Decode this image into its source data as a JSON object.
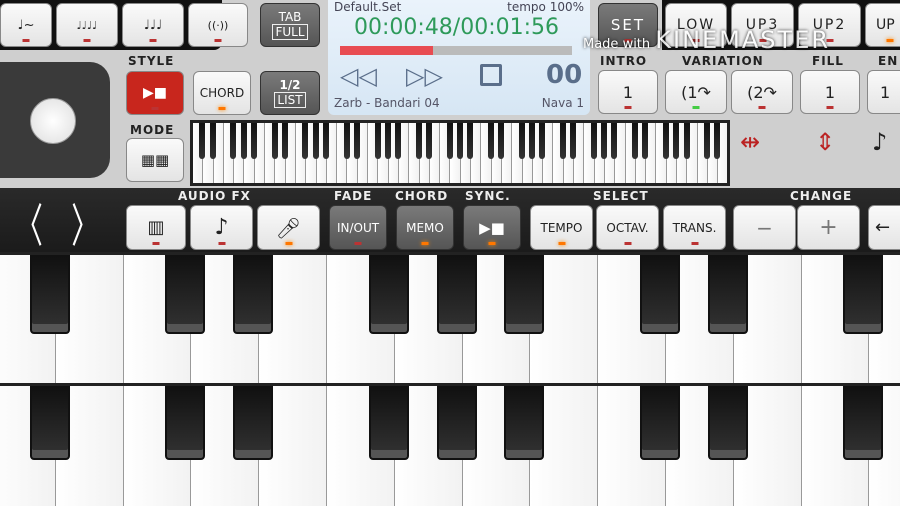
{
  "top_buttons": [
    {
      "icon": "note-tie-icon"
    },
    {
      "icon": "notes-decay-icon"
    },
    {
      "icon": "notes-staccato-icon"
    },
    {
      "icon": "vibrato-icon"
    }
  ],
  "tab_full": {
    "line1": "TAB",
    "line2": "FULL"
  },
  "style_label": "STYLE",
  "mode_label": "MODE",
  "chord_button": "CHORD",
  "list_button": {
    "line1": "1/2",
    "line2": "LIST"
  },
  "player": {
    "set_name": "Default.Set",
    "tempo": "tempo 100%",
    "time": "00:00:48/00:01:56",
    "progress": 0.4,
    "style_name": "Zarb - Bandari 04",
    "voice": "Nava 1",
    "accent": "#2e9a5a",
    "progress_color": "#e84c52"
  },
  "set_button": "SET",
  "parts": [
    "LOW",
    "UP3",
    "UP2",
    "UP"
  ],
  "watermark": {
    "made_with": "Made with",
    "brand": "KINEMASTER"
  },
  "sections": {
    "intro": "INTRO",
    "variation": "VARIATION",
    "fill": "FILL",
    "ending": "EN"
  },
  "section_buttons": [
    "1",
    "1",
    "2",
    "1",
    "1"
  ],
  "toolbar": {
    "audio_fx": "AUDIO FX",
    "fade": "FADE",
    "chord": "CHORD",
    "sync": "SYNC.",
    "select": "SELECT",
    "change": "CHANGE",
    "in_out": "IN/OUT",
    "memo": "MEMO",
    "tempo": "TEMPO",
    "octav": "OCTAV.",
    "trans": "TRANS.",
    "minus": "−",
    "plus": "+"
  }
}
